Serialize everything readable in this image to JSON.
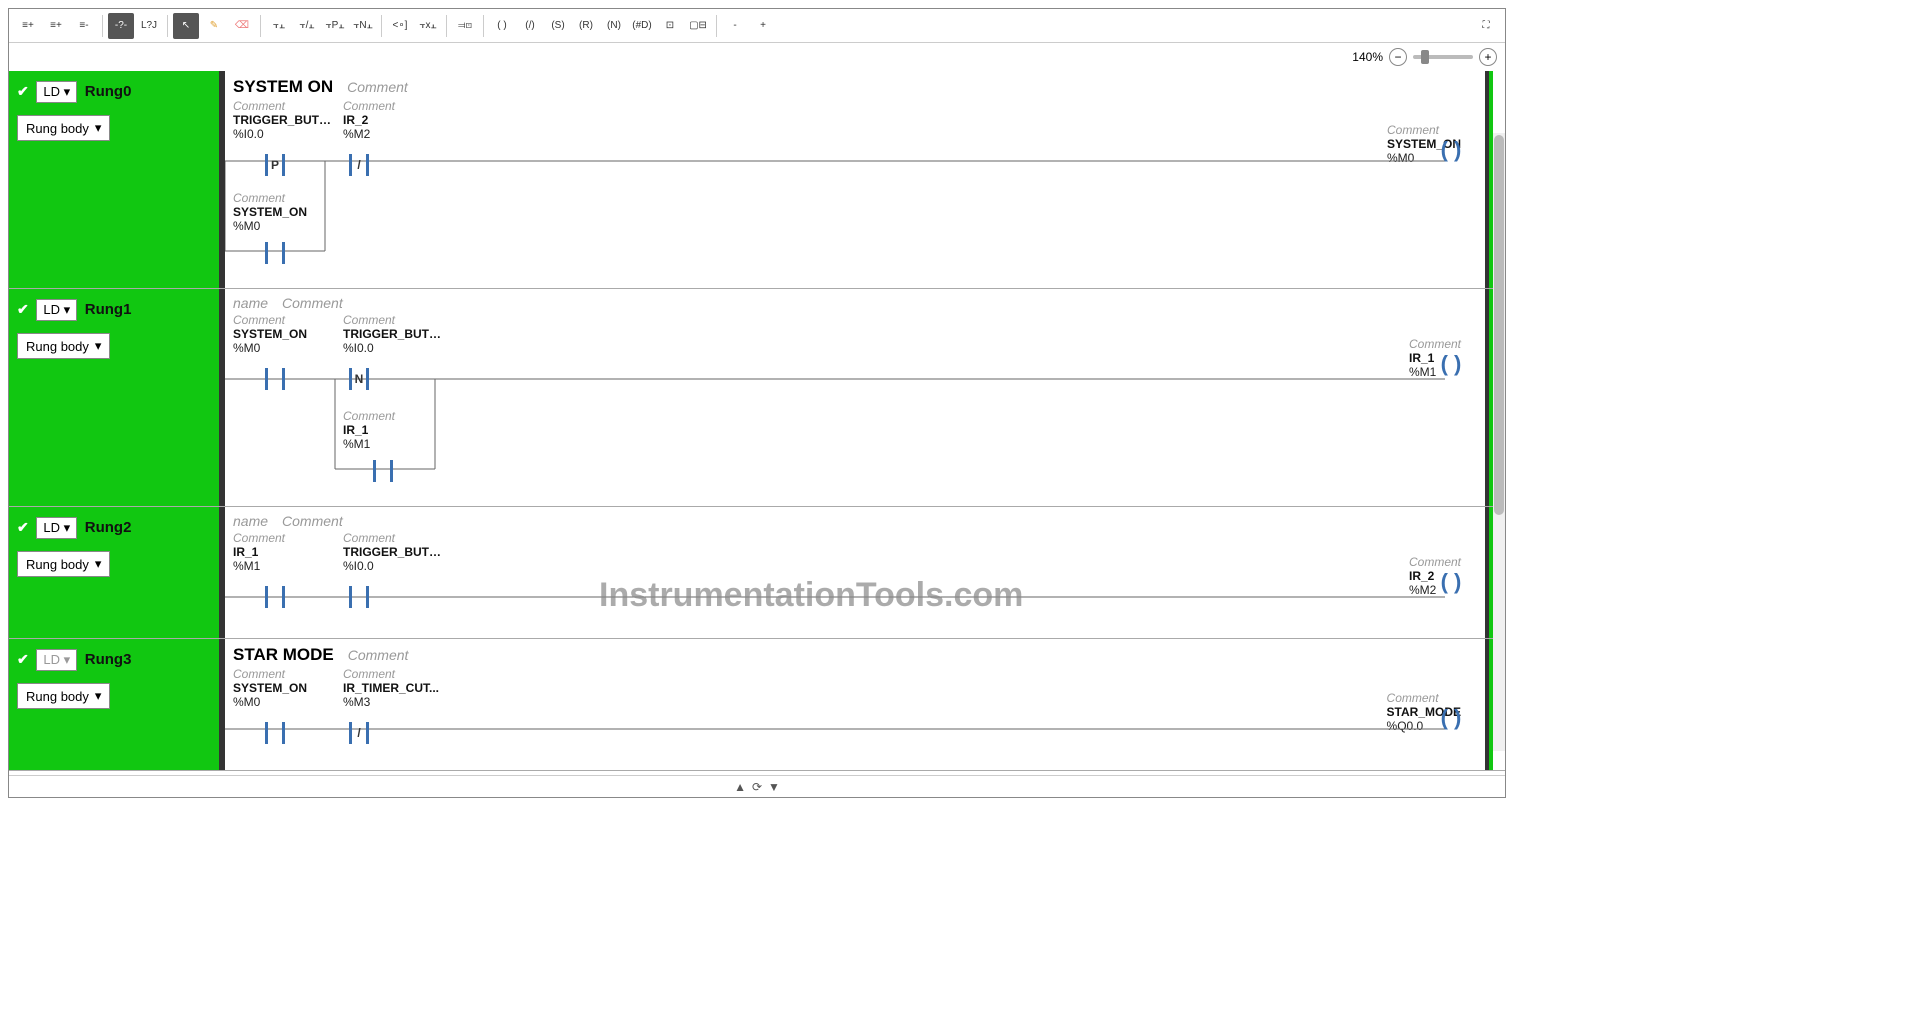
{
  "zoom": {
    "label": "140%"
  },
  "watermark": "InstrumentationTools.com",
  "bottom": {
    "sym1": "▲",
    "sym2": "⟳",
    "sym3": "▼"
  },
  "toolbar": {
    "insert_rung_before": "≡+",
    "insert_rung_after": "≡+",
    "delete_rung": "≡-",
    "undo_dark": "-?-",
    "redo": "L?J",
    "pointer": "↖",
    "draw": "✎",
    "erase": "⌫",
    "no_contact": "⫟⫠",
    "nc_contact": "⫟/⫠",
    "p_contact": "⫟P⫠",
    "n_contact": "⫟N⫠",
    "block1": "<∘]",
    "wide_contact": "⫟x⫠",
    "branch": "⫤⊡",
    "coil": "( )",
    "coil_neg": "(/)",
    "coil_s": "(S)",
    "coil_r": "(R)",
    "coil_n": "(N)",
    "coil_d": "(#D)",
    "block2": "⊡",
    "block3": "▢⊟",
    "minus": "-",
    "plus": "+",
    "fullscreen": "⛶"
  },
  "rungs": [
    {
      "name": "Rung0",
      "ld_enabled": true,
      "body": "Rung body",
      "title": "SYSTEM ON",
      "comment": "Comment",
      "name_ph": "",
      "col0": {
        "comment": "Comment",
        "name": "TRIGGER_BUTT...",
        "addr": "%I0.0",
        "sym": "P"
      },
      "col1": {
        "comment": "Comment",
        "name": "IR_2",
        "addr": "%M2",
        "sym": "/"
      },
      "col0b": {
        "comment": "Comment",
        "name": "SYSTEM_ON",
        "addr": "%M0",
        "sym": ""
      },
      "out": {
        "comment": "Comment",
        "name": "SYSTEM_ON",
        "addr": "%M0"
      }
    },
    {
      "name": "Rung1",
      "ld_enabled": true,
      "body": "Rung body",
      "title": "",
      "comment": "Comment",
      "name_ph": "name",
      "col0": {
        "comment": "Comment",
        "name": "SYSTEM_ON",
        "addr": "%M0",
        "sym": ""
      },
      "col1": {
        "comment": "Comment",
        "name": "TRIGGER_BUTT...",
        "addr": "%I0.0",
        "sym": "N"
      },
      "col1b": {
        "comment": "Comment",
        "name": "IR_1",
        "addr": "%M1",
        "sym": ""
      },
      "out": {
        "comment": "Comment",
        "name": "IR_1",
        "addr": "%M1"
      }
    },
    {
      "name": "Rung2",
      "ld_enabled": true,
      "body": "Rung body",
      "title": "",
      "comment": "Comment",
      "name_ph": "name",
      "col0": {
        "comment": "Comment",
        "name": "IR_1",
        "addr": "%M1",
        "sym": ""
      },
      "col1": {
        "comment": "Comment",
        "name": "TRIGGER_BUTT...",
        "addr": "%I0.0",
        "sym": ""
      },
      "out": {
        "comment": "Comment",
        "name": "IR_2",
        "addr": "%M2"
      }
    },
    {
      "name": "Rung3",
      "ld_enabled": false,
      "body": "Rung body",
      "title": "STAR MODE",
      "comment": "Comment",
      "name_ph": "",
      "col0": {
        "comment": "Comment",
        "name": "SYSTEM_ON",
        "addr": "%M0",
        "sym": ""
      },
      "col1": {
        "comment": "Comment",
        "name": "IR_TIMER_CUT...",
        "addr": "%M3",
        "sym": "/"
      },
      "out": {
        "comment": "Comment",
        "name": "STAR_MODE",
        "addr": "%Q0.0"
      }
    }
  ]
}
